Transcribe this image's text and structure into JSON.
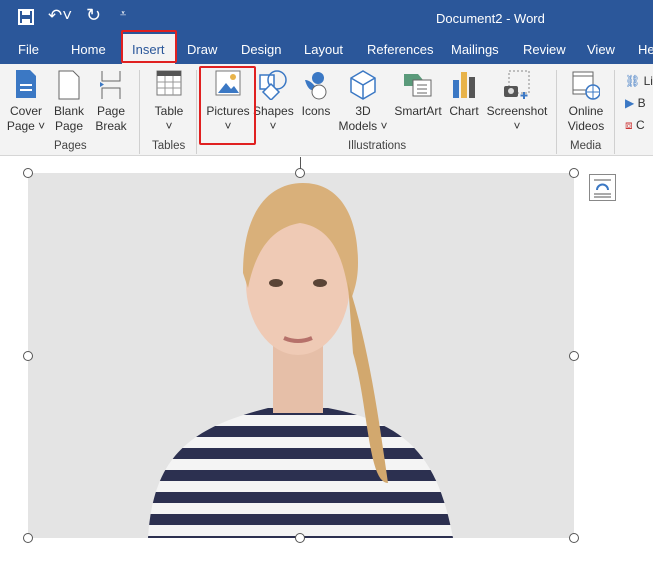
{
  "title": "Document2  -  Word",
  "quick_access": {
    "save": "save-icon",
    "undo": "undo-icon",
    "redo": "redo-icon",
    "customize": "customize-icon"
  },
  "tabs": [
    "File",
    "Home",
    "Insert",
    "Draw",
    "Design",
    "Layout",
    "References",
    "Mailings",
    "Review",
    "View",
    "He"
  ],
  "active_tab": "Insert",
  "ribbon": {
    "pages": {
      "label": "Pages",
      "cover": "Cover",
      "cover2": "Page ˅",
      "blank": "Blank",
      "blank2": "Page",
      "break": "Page",
      "break2": "Break"
    },
    "tables": {
      "label": "Tables",
      "table": "Table",
      "chev": "˅"
    },
    "illustrations": {
      "label": "Illustrations",
      "pictures": "Pictures",
      "shapes": "Shapes",
      "icons": "Icons",
      "models": "3D",
      "models2": "Models ˅",
      "smartart": "SmartArt",
      "chart": "Chart",
      "screenshot": "Screenshot",
      "chev": "˅"
    },
    "media": {
      "label": "Media",
      "online": "Online",
      "online2": "Videos"
    },
    "links": {
      "l1": "Li",
      "l2": "B",
      "l3": "C"
    }
  },
  "colors": {
    "brand": "#2b579a",
    "highlight": "#e02020"
  }
}
